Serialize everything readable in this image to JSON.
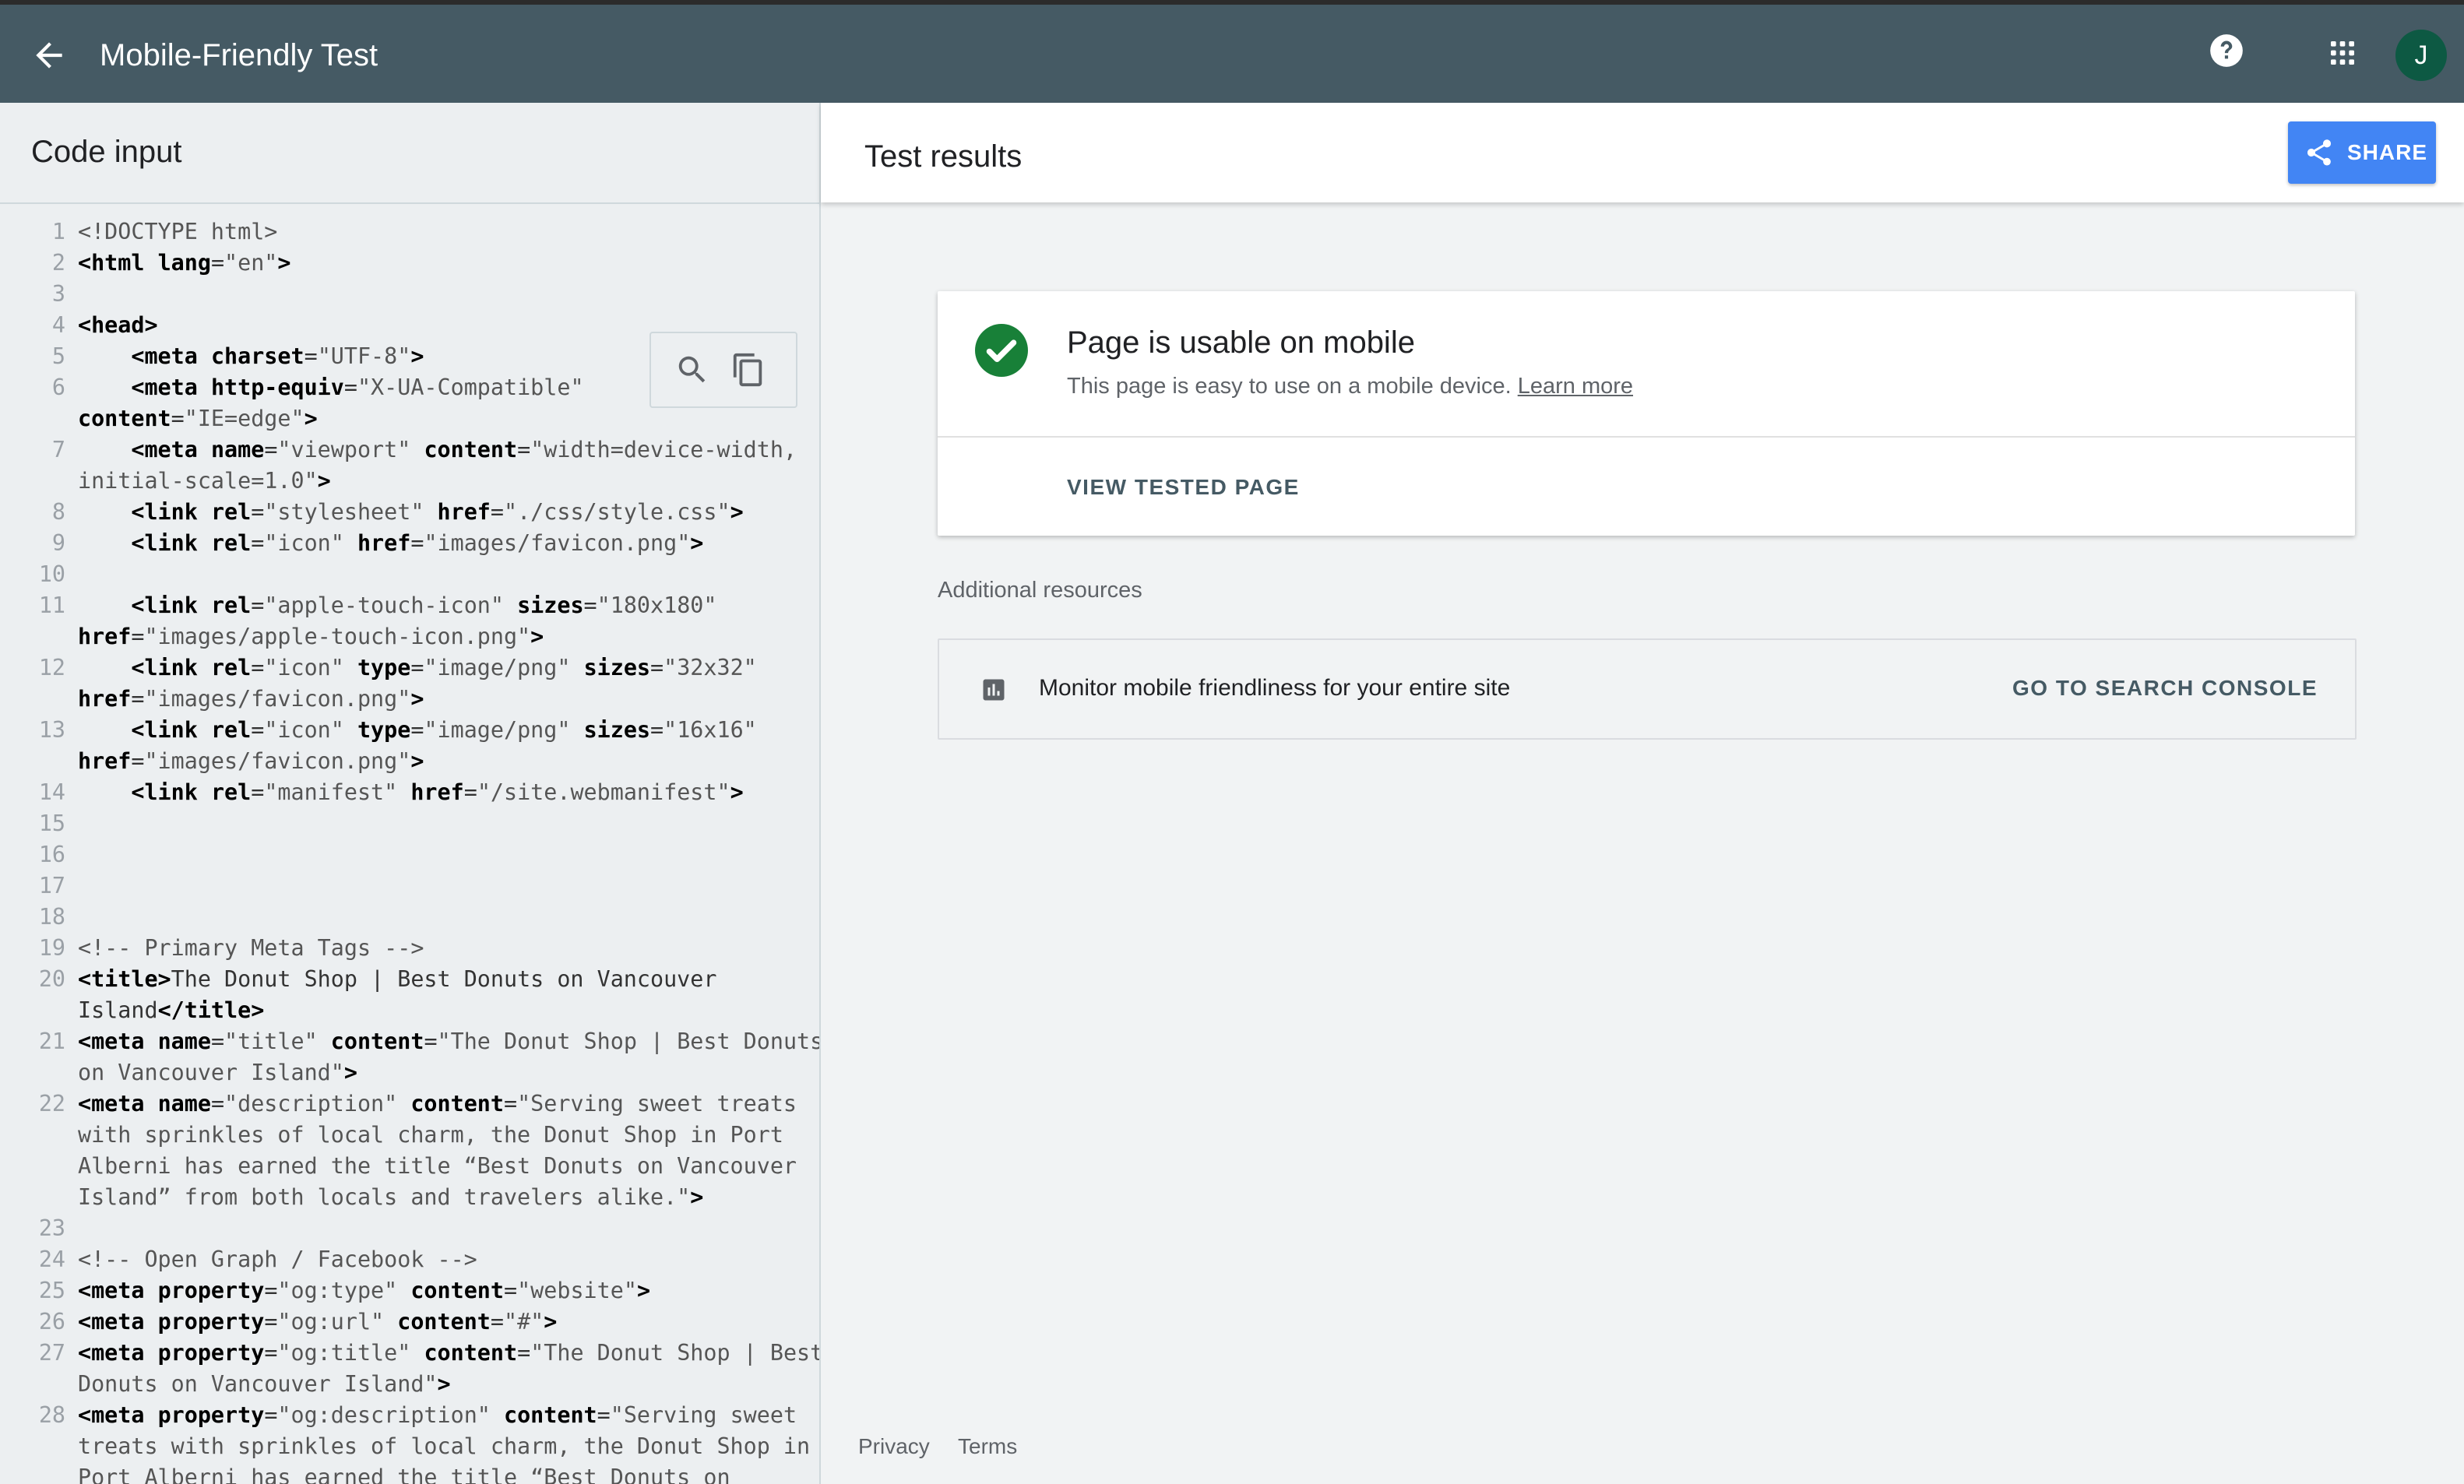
{
  "app": {
    "title": "Mobile-Friendly Test",
    "avatar_letter": "J",
    "icons": {
      "back": "arrow-back-icon",
      "help": "help-circle-icon",
      "apps": "apps-grid-icon"
    }
  },
  "code_panel": {
    "title": "Code input",
    "tools": [
      "search-icon",
      "copy-icon"
    ]
  },
  "code_lines": [
    {
      "n": "1",
      "segs": [
        [
          "cmt",
          "<!DOCTYPE html>"
        ]
      ]
    },
    {
      "n": "2",
      "segs": [
        [
          "tag",
          "<html "
        ],
        [
          "attr",
          "lang"
        ],
        [
          "plain",
          "="
        ],
        [
          "str",
          "\"en\""
        ],
        [
          "tag",
          ">"
        ]
      ]
    },
    {
      "n": "3",
      "segs": []
    },
    {
      "n": "4",
      "segs": [
        [
          "tag",
          "<head>"
        ]
      ]
    },
    {
      "n": "5",
      "segs": [
        [
          "plain",
          "    "
        ],
        [
          "tag",
          "<meta "
        ],
        [
          "attr",
          "charset"
        ],
        [
          "plain",
          "="
        ],
        [
          "str",
          "\"UTF-8\""
        ],
        [
          "tag",
          ">"
        ]
      ]
    },
    {
      "n": "6",
      "segs": [
        [
          "plain",
          "    "
        ],
        [
          "tag",
          "<meta "
        ],
        [
          "attr",
          "http-equiv"
        ],
        [
          "plain",
          "="
        ],
        [
          "str",
          "\"X-UA-Compatible\""
        ]
      ]
    },
    {
      "n": "",
      "segs": [
        [
          "attr",
          "content"
        ],
        [
          "plain",
          "="
        ],
        [
          "str",
          "\"IE=edge\""
        ],
        [
          "tag",
          ">"
        ]
      ]
    },
    {
      "n": "7",
      "segs": [
        [
          "plain",
          "    "
        ],
        [
          "tag",
          "<meta "
        ],
        [
          "attr",
          "name"
        ],
        [
          "plain",
          "="
        ],
        [
          "str",
          "\"viewport\" "
        ],
        [
          "attr",
          "content"
        ],
        [
          "plain",
          "="
        ],
        [
          "str",
          "\"width=device-width,"
        ]
      ]
    },
    {
      "n": "",
      "segs": [
        [
          "str",
          "initial-scale=1.0\""
        ],
        [
          "tag",
          ">"
        ]
      ]
    },
    {
      "n": "8",
      "segs": [
        [
          "plain",
          "    "
        ],
        [
          "tag",
          "<link "
        ],
        [
          "attr",
          "rel"
        ],
        [
          "plain",
          "="
        ],
        [
          "str",
          "\"stylesheet\" "
        ],
        [
          "attr",
          "href"
        ],
        [
          "plain",
          "="
        ],
        [
          "str",
          "\"./css/style.css\""
        ],
        [
          "tag",
          ">"
        ]
      ]
    },
    {
      "n": "9",
      "segs": [
        [
          "plain",
          "    "
        ],
        [
          "tag",
          "<link "
        ],
        [
          "attr",
          "rel"
        ],
        [
          "plain",
          "="
        ],
        [
          "str",
          "\"icon\" "
        ],
        [
          "attr",
          "href"
        ],
        [
          "plain",
          "="
        ],
        [
          "str",
          "\"images/favicon.png\""
        ],
        [
          "tag",
          ">"
        ]
      ]
    },
    {
      "n": "10",
      "segs": []
    },
    {
      "n": "11",
      "segs": [
        [
          "plain",
          "    "
        ],
        [
          "tag",
          "<link "
        ],
        [
          "attr",
          "rel"
        ],
        [
          "plain",
          "="
        ],
        [
          "str",
          "\"apple-touch-icon\" "
        ],
        [
          "attr",
          "sizes"
        ],
        [
          "plain",
          "="
        ],
        [
          "str",
          "\"180x180\""
        ]
      ]
    },
    {
      "n": "",
      "segs": [
        [
          "attr",
          "href"
        ],
        [
          "plain",
          "="
        ],
        [
          "str",
          "\"images/apple-touch-icon.png\""
        ],
        [
          "tag",
          ">"
        ]
      ]
    },
    {
      "n": "12",
      "segs": [
        [
          "plain",
          "    "
        ],
        [
          "tag",
          "<link "
        ],
        [
          "attr",
          "rel"
        ],
        [
          "plain",
          "="
        ],
        [
          "str",
          "\"icon\" "
        ],
        [
          "attr",
          "type"
        ],
        [
          "plain",
          "="
        ],
        [
          "str",
          "\"image/png\" "
        ],
        [
          "attr",
          "sizes"
        ],
        [
          "plain",
          "="
        ],
        [
          "str",
          "\"32x32\""
        ]
      ]
    },
    {
      "n": "",
      "segs": [
        [
          "attr",
          "href"
        ],
        [
          "plain",
          "="
        ],
        [
          "str",
          "\"images/favicon.png\""
        ],
        [
          "tag",
          ">"
        ]
      ]
    },
    {
      "n": "13",
      "segs": [
        [
          "plain",
          "    "
        ],
        [
          "tag",
          "<link "
        ],
        [
          "attr",
          "rel"
        ],
        [
          "plain",
          "="
        ],
        [
          "str",
          "\"icon\" "
        ],
        [
          "attr",
          "type"
        ],
        [
          "plain",
          "="
        ],
        [
          "str",
          "\"image/png\" "
        ],
        [
          "attr",
          "sizes"
        ],
        [
          "plain",
          "="
        ],
        [
          "str",
          "\"16x16\""
        ]
      ]
    },
    {
      "n": "",
      "segs": [
        [
          "attr",
          "href"
        ],
        [
          "plain",
          "="
        ],
        [
          "str",
          "\"images/favicon.png\""
        ],
        [
          "tag",
          ">"
        ]
      ]
    },
    {
      "n": "14",
      "segs": [
        [
          "plain",
          "    "
        ],
        [
          "tag",
          "<link "
        ],
        [
          "attr",
          "rel"
        ],
        [
          "plain",
          "="
        ],
        [
          "str",
          "\"manifest\" "
        ],
        [
          "attr",
          "href"
        ],
        [
          "plain",
          "="
        ],
        [
          "str",
          "\"/site.webmanifest\""
        ],
        [
          "tag",
          ">"
        ]
      ]
    },
    {
      "n": "15",
      "segs": []
    },
    {
      "n": "16",
      "segs": []
    },
    {
      "n": "17",
      "segs": []
    },
    {
      "n": "18",
      "segs": []
    },
    {
      "n": "19",
      "segs": [
        [
          "cmt",
          "<!-- Primary Meta Tags -->"
        ]
      ]
    },
    {
      "n": "20",
      "segs": [
        [
          "tag",
          "<title>"
        ],
        [
          "plain",
          "The Donut Shop | Best Donuts on Vancouver"
        ]
      ]
    },
    {
      "n": "",
      "segs": [
        [
          "plain",
          "Island"
        ],
        [
          "tag",
          "</title>"
        ]
      ]
    },
    {
      "n": "21",
      "segs": [
        [
          "tag",
          "<meta "
        ],
        [
          "attr",
          "name"
        ],
        [
          "plain",
          "="
        ],
        [
          "str",
          "\"title\" "
        ],
        [
          "attr",
          "content"
        ],
        [
          "plain",
          "="
        ],
        [
          "str",
          "\"The Donut Shop | Best Donuts"
        ]
      ]
    },
    {
      "n": "",
      "segs": [
        [
          "str",
          "on Vancouver Island\""
        ],
        [
          "tag",
          ">"
        ]
      ]
    },
    {
      "n": "22",
      "segs": [
        [
          "tag",
          "<meta "
        ],
        [
          "attr",
          "name"
        ],
        [
          "plain",
          "="
        ],
        [
          "str",
          "\"description\" "
        ],
        [
          "attr",
          "content"
        ],
        [
          "plain",
          "="
        ],
        [
          "str",
          "\"Serving sweet treats"
        ]
      ]
    },
    {
      "n": "",
      "segs": [
        [
          "str",
          "with sprinkles of local charm, the Donut Shop in Port"
        ]
      ]
    },
    {
      "n": "",
      "segs": [
        [
          "str",
          "Alberni has earned the title “Best Donuts on Vancouver"
        ]
      ]
    },
    {
      "n": "",
      "segs": [
        [
          "str",
          "Island” from both locals and travelers alike.\""
        ],
        [
          "tag",
          ">"
        ]
      ]
    },
    {
      "n": "23",
      "segs": []
    },
    {
      "n": "24",
      "segs": [
        [
          "cmt",
          "<!-- Open Graph / Facebook -->"
        ]
      ]
    },
    {
      "n": "25",
      "segs": [
        [
          "tag",
          "<meta "
        ],
        [
          "attr",
          "property"
        ],
        [
          "plain",
          "="
        ],
        [
          "str",
          "\"og:type\" "
        ],
        [
          "attr",
          "content"
        ],
        [
          "plain",
          "="
        ],
        [
          "str",
          "\"website\""
        ],
        [
          "tag",
          ">"
        ]
      ]
    },
    {
      "n": "26",
      "segs": [
        [
          "tag",
          "<meta "
        ],
        [
          "attr",
          "property"
        ],
        [
          "plain",
          "="
        ],
        [
          "str",
          "\"og:url\" "
        ],
        [
          "attr",
          "content"
        ],
        [
          "plain",
          "="
        ],
        [
          "str",
          "\"#\""
        ],
        [
          "tag",
          ">"
        ]
      ]
    },
    {
      "n": "27",
      "segs": [
        [
          "tag",
          "<meta "
        ],
        [
          "attr",
          "property"
        ],
        [
          "plain",
          "="
        ],
        [
          "str",
          "\"og:title\" "
        ],
        [
          "attr",
          "content"
        ],
        [
          "plain",
          "="
        ],
        [
          "str",
          "\"The Donut Shop | Best"
        ]
      ]
    },
    {
      "n": "",
      "segs": [
        [
          "str",
          "Donuts on Vancouver Island\""
        ],
        [
          "tag",
          ">"
        ]
      ]
    },
    {
      "n": "28",
      "segs": [
        [
          "tag",
          "<meta "
        ],
        [
          "attr",
          "property"
        ],
        [
          "plain",
          "="
        ],
        [
          "str",
          "\"og:description\" "
        ],
        [
          "attr",
          "content"
        ],
        [
          "plain",
          "="
        ],
        [
          "str",
          "\"Serving sweet"
        ]
      ]
    },
    {
      "n": "",
      "segs": [
        [
          "str",
          "treats with sprinkles of local charm, the Donut Shop in"
        ]
      ]
    },
    {
      "n": "",
      "segs": [
        [
          "str",
          "Port Alberni has earned the title “Best Donuts on"
        ]
      ]
    }
  ],
  "results_panel": {
    "title": "Test results",
    "share_label": "SHARE"
  },
  "result_card": {
    "title": "Page is usable on mobile",
    "description": "This page is easy to use on a mobile device. ",
    "learn_more": "Learn more",
    "view_tested_page": "VIEW TESTED PAGE"
  },
  "resources": {
    "heading": "Additional resources",
    "item_text": "Monitor mobile friendliness for your entire site",
    "item_action": "GO TO SEARCH CONSOLE"
  },
  "footer": {
    "privacy": "Privacy",
    "terms": "Terms"
  },
  "colors": {
    "appbar": "#455a64",
    "share": "#4285f4",
    "success": "#188038",
    "avatar": "#0d5943"
  }
}
